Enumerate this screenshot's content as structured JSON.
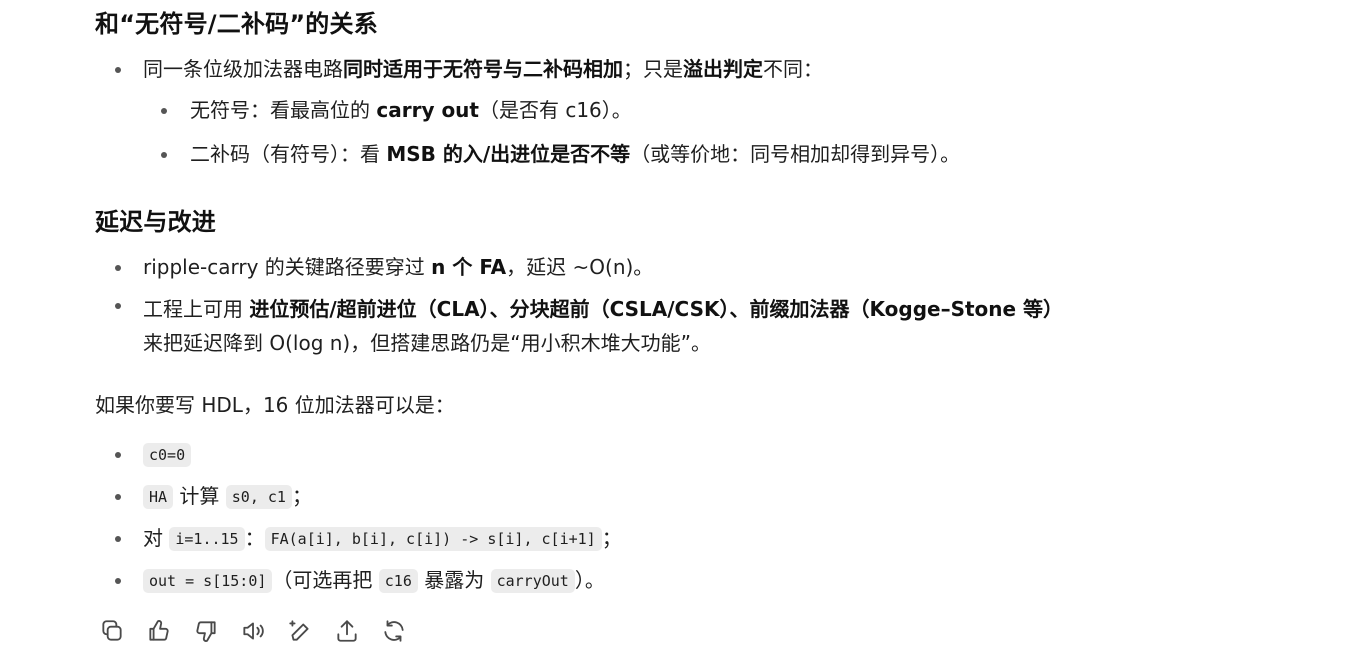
{
  "section1": {
    "title": "和“无符号/二补码”的关系",
    "items": [
      {
        "t1": "同一条位级加法器电路",
        "b1": "同时适用于无符号与二补码相加",
        "t2": "；只是",
        "b2": "溢出判定",
        "t3": "不同："
      }
    ],
    "sub": [
      {
        "t1": "无符号：看最高位的 ",
        "b1": "carry out",
        "t2": "（是否有 c16）。"
      },
      {
        "t1": "二补码（有符号）：看 ",
        "b1": "MSB 的入/出进位是否不等",
        "t2": "（或等价地：同号相加却得到异号）。"
      }
    ]
  },
  "section2": {
    "title": "延迟与改进",
    "items": [
      {
        "t1": "ripple-carry 的关键路径要穿过 ",
        "b1": "n 个 FA",
        "t2": "，延迟 ~O(n)。"
      },
      {
        "t1": "工程上可用 ",
        "b1": "进位预估/超前进位（CLA）、分块超前（CSLA/CSK）、前缀加法器（Kogge–Stone 等）",
        "t2": "来把延迟降到 O(log n)，但搭建思路仍是“用小积木堆大功能”。"
      }
    ]
  },
  "hdl": {
    "intro": "如果你要写 HDL，16 位加法器可以是：",
    "line1_code": "c0=0",
    "line2_code1": "HA",
    "line2_text1": " 计算 ",
    "line2_code2": "s0, c1",
    "line2_text2": "；",
    "line3_text1": "对 ",
    "line3_code1": "i=1..15",
    "line3_text2": "：",
    "line3_code2": "FA(a[i], b[i], c[i]) -> s[i], c[i+1]",
    "line3_text3": "；",
    "line4_code1": "out = s[15:0]",
    "line4_text1": "（可选再把 ",
    "line4_code2": "c16",
    "line4_text2": " 暴露为 ",
    "line4_code3": "carryOut",
    "line4_text3": "）。"
  },
  "actions": [
    "copy-icon",
    "thumbs-up-icon",
    "thumbs-down-icon",
    "read-aloud-icon",
    "edit-icon",
    "share-icon",
    "regenerate-icon"
  ]
}
